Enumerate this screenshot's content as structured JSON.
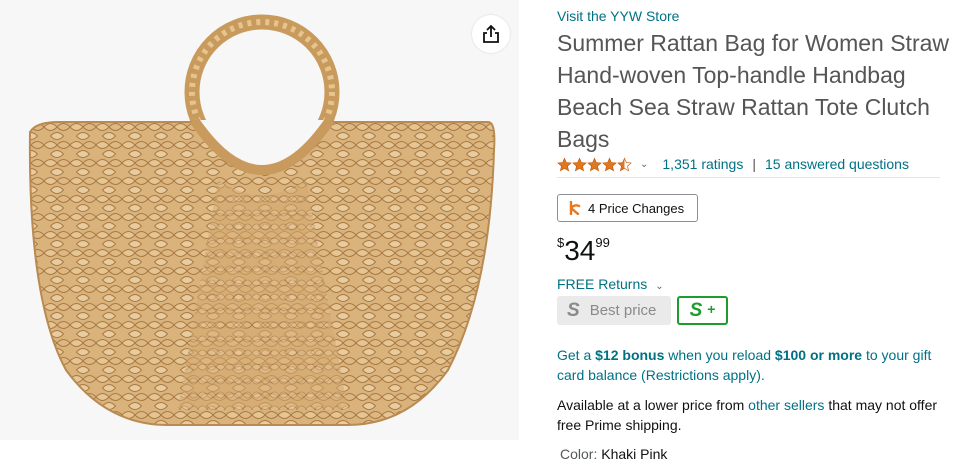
{
  "store": {
    "link": "Visit the YYW Store"
  },
  "product": {
    "title": "Summer Rattan Bag for Women Straw Hand-woven Top-handle Handbag Beach Sea Straw Rattan Tote Clutch Bags",
    "image_icon": "woven-straw-bag"
  },
  "rating": {
    "stars": 4.5,
    "ratings_text": "1,351 ratings",
    "separator": "|",
    "answered_text": "15 answered questions"
  },
  "price_changes": {
    "label": "4 Price Changes",
    "icon": "keepa-icon"
  },
  "price": {
    "symbol": "$",
    "whole": "34",
    "fraction": "99"
  },
  "returns": {
    "label": "FREE Returns"
  },
  "badges": {
    "best_price_s": "S",
    "best_price_label": "Best price",
    "splus_s": "S",
    "splus_plus": "+"
  },
  "bonus": {
    "p1": "Get a ",
    "amount": "$12 bonus",
    "p2": " when you reload ",
    "reload": "$100 or more",
    "p3": " to your gift card balance (Restrictions apply)."
  },
  "availability": {
    "p1": "Available at a lower price from ",
    "link": "other sellers",
    "p2": " that may not offer free Prime shipping."
  },
  "color": {
    "label": "Color:",
    "value": "Khaki Pink"
  },
  "colors": {
    "link": "#007185",
    "star": "#de7921",
    "title": "#555555",
    "splus_green": "#1d9d2d"
  }
}
